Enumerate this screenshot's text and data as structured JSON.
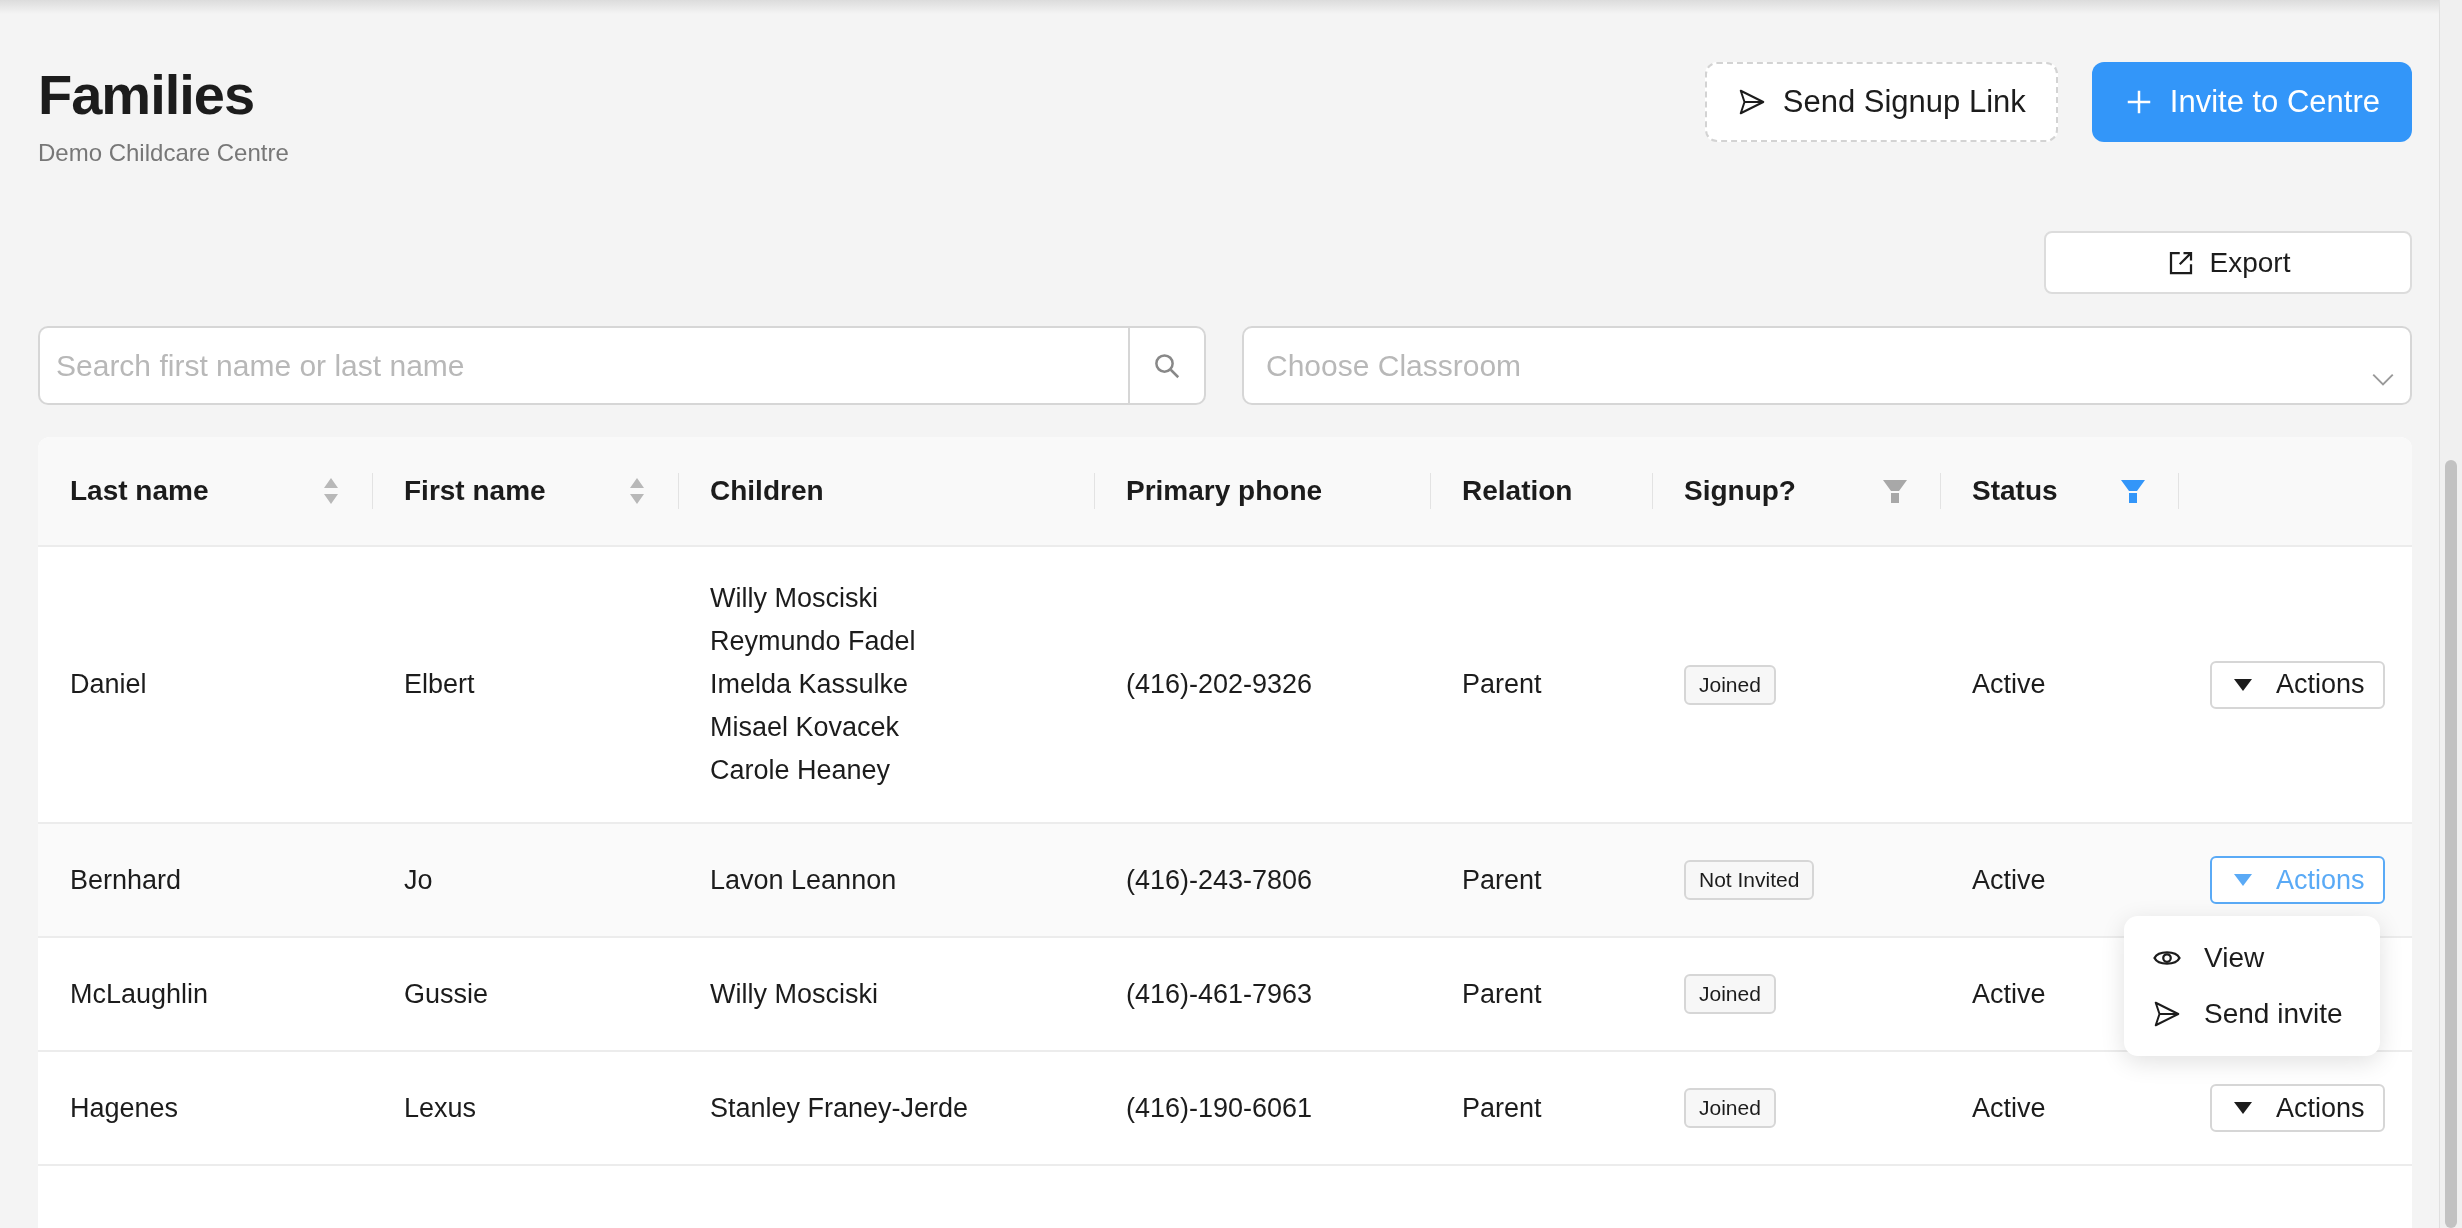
{
  "page": {
    "title": "Families",
    "subtitle": "Demo Childcare Centre"
  },
  "header_buttons": [
    {
      "kind": "send",
      "label": "Send Signup Link"
    },
    {
      "kind": "invite",
      "label": "Invite to Centre"
    }
  ],
  "export_button": {
    "label": "Export"
  },
  "search": {
    "placeholder": "Search first name or last name"
  },
  "classroom_select": {
    "placeholder": "Choose Classroom"
  },
  "table": {
    "columns": [
      {
        "label": "Last name",
        "kind": "sort"
      },
      {
        "label": "First name",
        "kind": "sort"
      },
      {
        "label": "Children",
        "kind": "none"
      },
      {
        "label": "Primary phone",
        "kind": "none"
      },
      {
        "label": "Relation",
        "kind": "none"
      },
      {
        "label": "Signup?",
        "kind": "filter",
        "active": false
      },
      {
        "label": "Status",
        "kind": "filter",
        "active": true
      }
    ],
    "rows": [
      {
        "last_name": "Daniel",
        "first_name": "Elbert",
        "children": [
          "Willy Mosciski",
          "Reymundo Fadel",
          "Imelda Kassulke",
          "Misael Kovacek",
          "Carole Heaney"
        ],
        "phone": "(416)-202-9326",
        "relation": "Parent",
        "signup": "Joined",
        "status": "Active",
        "action": "Actions",
        "menu_open": false
      },
      {
        "last_name": "Bernhard",
        "first_name": "Jo",
        "children": [
          "Lavon Leannon"
        ],
        "phone": "(416)-243-7806",
        "relation": "Parent",
        "signup": "Not Invited",
        "status": "Active",
        "action": "Actions",
        "menu_open": true
      },
      {
        "last_name": "McLaughlin",
        "first_name": "Gussie",
        "children": [
          "Willy Mosciski"
        ],
        "phone": "(416)-461-7963",
        "relation": "Parent",
        "signup": "Joined",
        "status": "Active",
        "menu_open": false
      },
      {
        "last_name": "Hagenes",
        "first_name": "Lexus",
        "children": [
          "Stanley Franey-Jerde"
        ],
        "phone": "(416)-190-6061",
        "relation": "Parent",
        "signup": "Joined",
        "status": "Active",
        "action": "Actions",
        "menu_open": false
      }
    ]
  },
  "action_menu": {
    "items": [
      {
        "kind": "view",
        "label": "View"
      },
      {
        "kind": "send",
        "label": "Send invite"
      }
    ]
  }
}
